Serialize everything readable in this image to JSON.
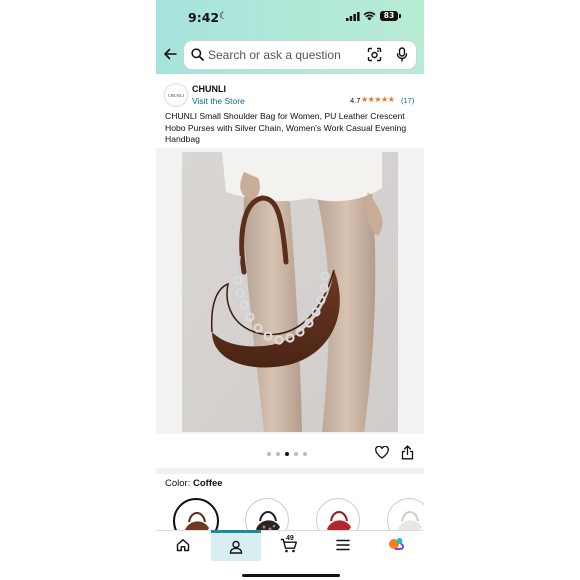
{
  "status_bar": {
    "time": "9:42",
    "battery": "83"
  },
  "search": {
    "placeholder": "Search or ask a question"
  },
  "brand": {
    "logo_text": "CHUNLI",
    "name": "CHUNLI",
    "visit_store": "Visit the Store",
    "rating": "4.7",
    "stars": "★★★★★",
    "rating_count": "(17)"
  },
  "product": {
    "title": "CHUNLI Small Shoulder Bag for Women, PU Leather Crescent Hobo Purses with Silver Chain, Women's Work Casual Evening Handbag",
    "image_label": "brown crescent shoulder bag with silver chain",
    "image_count": 5,
    "current_image": 3
  },
  "color": {
    "label": "Color:",
    "value": "Coffee",
    "options": [
      "Coffee",
      "Black Leopard",
      "Red",
      "White"
    ]
  },
  "tabs": {
    "cart_count": "49"
  },
  "colors": {
    "accent": "#1f8b9a",
    "link": "#007185",
    "star": "#de7921",
    "header_gradient_start": "#a6e3dc",
    "header_gradient_end": "#b9ecd5"
  }
}
